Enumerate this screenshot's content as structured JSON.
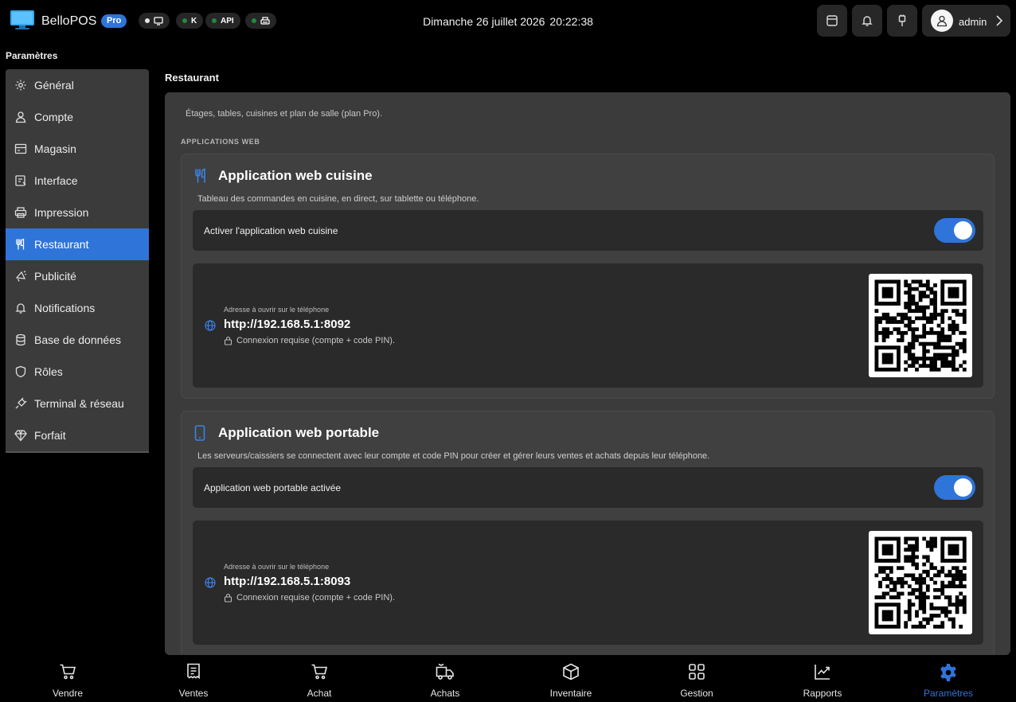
{
  "header": {
    "app_name": "BelloPOS",
    "badge": "Pro",
    "status": [
      {
        "icon": "monitor-icon",
        "label": "",
        "dot": "white"
      },
      {
        "icon": "",
        "label": "K",
        "dot": "green"
      },
      {
        "icon": "",
        "label": "API",
        "dot": "green"
      },
      {
        "icon": "printer-icon",
        "label": "",
        "dot": "green"
      }
    ],
    "date": "Dimanche 26 juillet 2026",
    "time": "20:22:38",
    "username": "admin",
    "accent": "#2f74d8"
  },
  "sidebar": {
    "title": "Paramètres",
    "items": [
      {
        "label": "Général",
        "icon": "gear-icon"
      },
      {
        "label": "Compte",
        "icon": "user-icon"
      },
      {
        "label": "Magasin",
        "icon": "store-icon"
      },
      {
        "label": "Interface",
        "icon": "interface-icon"
      },
      {
        "label": "Impression",
        "icon": "printer-icon"
      },
      {
        "label": "Restaurant",
        "icon": "utensils-icon",
        "active": true
      },
      {
        "label": "Publicité",
        "icon": "megaphone-icon"
      },
      {
        "label": "Notifications",
        "icon": "bell-icon"
      },
      {
        "label": "Base de données",
        "icon": "database-icon"
      },
      {
        "label": "Rôles",
        "icon": "shield-icon"
      },
      {
        "label": "Terminal & réseau",
        "icon": "plug-icon"
      },
      {
        "label": "Forfait",
        "icon": "diamond-icon"
      }
    ]
  },
  "main": {
    "title": "Restaurant",
    "description": "Étages, tables, cuisines et plan de salle (plan Pro).",
    "section_label": "APPLICATIONS WEB",
    "cards": [
      {
        "icon": "utensils-icon",
        "title": "Application web cuisine",
        "description": "Tableau des commandes en cuisine, en direct, sur tablette ou téléphone.",
        "toggle_label": "Activer l'application web cuisine",
        "toggle_on": true,
        "url_caption": "Adresse à ouvrir sur le téléphone",
        "url": "http://192.168.5.1:8092",
        "note": "Connexion requise (compte + code PIN)."
      },
      {
        "icon": "smartphone-icon",
        "title": "Application web portable",
        "description": "Les serveurs/caissiers se connectent avec leur compte et code PIN pour créer et gérer leurs ventes et achats depuis leur téléphone.",
        "toggle_label": "Application web portable activée",
        "toggle_on": true,
        "url_caption": "Adresse à ouvrir sur le téléphone",
        "url": "http://192.168.5.1:8093",
        "note": "Connexion requise (compte + code PIN)."
      }
    ]
  },
  "bottom_nav": [
    {
      "label": "Vendre",
      "icon": "cart-icon"
    },
    {
      "label": "Ventes",
      "icon": "receipt-icon"
    },
    {
      "label": "Achat",
      "icon": "cart-icon"
    },
    {
      "label": "Achats",
      "icon": "truck-icon"
    },
    {
      "label": "Inventaire",
      "icon": "box-icon"
    },
    {
      "label": "Gestion",
      "icon": "grid-icon"
    },
    {
      "label": "Rapports",
      "icon": "chart-icon"
    },
    {
      "label": "Paramètres",
      "icon": "gear-icon",
      "active": true
    }
  ]
}
